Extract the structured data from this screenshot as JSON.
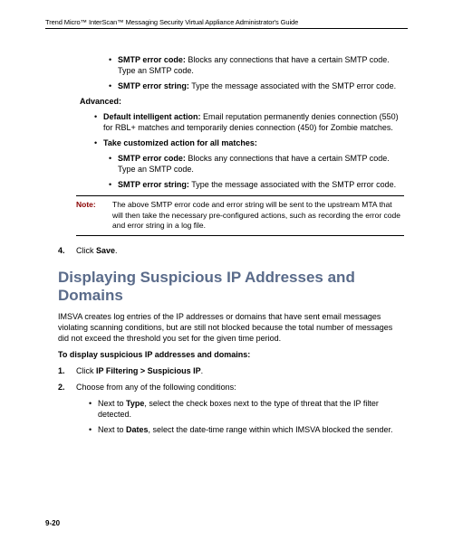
{
  "header": "Trend Micro™ InterScan™ Messaging Security Virtual Appliance Administrator's Guide",
  "pageNumber": "9-20",
  "bullets1": {
    "a": {
      "label": "SMTP error code:",
      "text": " Blocks any connections that have a certain SMTP code. Type an SMTP code."
    },
    "b": {
      "label": "SMTP error string:",
      "text": " Type the message associated with the SMTP error code."
    }
  },
  "advancedLabel": "Advanced:",
  "advBullets": {
    "a": {
      "label": "Default intelligent action:",
      "text": " Email reputation permanently denies connection (550) for RBL+ matches and temporarily denies connection (450) for Zombie matches."
    },
    "b": {
      "label": "Take customized action for all matches:",
      "text": ""
    }
  },
  "advSub": {
    "a": {
      "label": "SMTP error code:",
      "text": " Blocks any connections that have a certain SMTP code. Type an SMTP code."
    },
    "b": {
      "label": "SMTP error string:",
      "text": " Type the message associated with the SMTP error code."
    }
  },
  "note": {
    "label": "Note:",
    "text": "The above SMTP error code and error string will be sent to the upstream MTA that will then take the necessary pre-configured actions, such as recording the error code and error string in a log file."
  },
  "step4": {
    "num": "4.",
    "pre": "Click ",
    "bold": "Save",
    "post": "."
  },
  "sectionTitle": "Displaying Suspicious IP Addresses and Domains",
  "intro": "IMSVA creates log entries of the IP addresses or domains that have sent email messages violating scanning conditions, but are still not blocked because the total number of messages did not exceed the threshold you set for the given time period.",
  "subhead": "To display suspicious IP addresses and domains:",
  "steps": {
    "s1": {
      "num": "1.",
      "pre": "Click ",
      "bold": "IP Filtering > Suspicious IP",
      "post": "."
    },
    "s2": {
      "num": "2.",
      "text": "Choose from any of the following conditions:"
    }
  },
  "condBullets": {
    "a": {
      "pre": "Next to ",
      "bold": "Type",
      "post": ", select the check boxes next to the type of threat that the IP filter detected."
    },
    "b": {
      "pre": "Next to ",
      "bold": "Dates",
      "post": ", select the date-time range within which IMSVA blocked the sender."
    }
  }
}
